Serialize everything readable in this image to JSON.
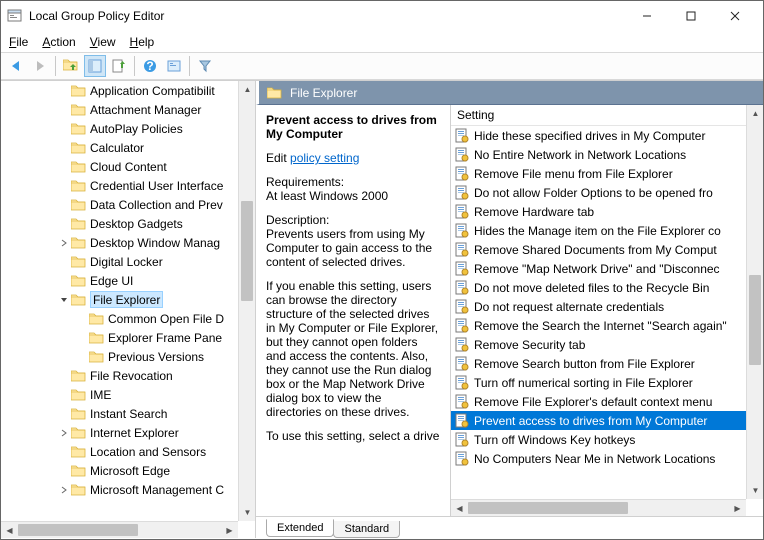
{
  "window": {
    "title": "Local Group Policy Editor"
  },
  "menu": {
    "file": "File",
    "action": "Action",
    "view": "View",
    "help": "Help"
  },
  "tree": {
    "items": [
      {
        "indent": 2,
        "exp": "",
        "label": "Application Compatibilit"
      },
      {
        "indent": 2,
        "exp": "",
        "label": "Attachment Manager"
      },
      {
        "indent": 2,
        "exp": "",
        "label": "AutoPlay Policies"
      },
      {
        "indent": 2,
        "exp": "",
        "label": "Calculator"
      },
      {
        "indent": 2,
        "exp": "",
        "label": "Cloud Content"
      },
      {
        "indent": 2,
        "exp": "",
        "label": "Credential User Interface"
      },
      {
        "indent": 2,
        "exp": "",
        "label": "Data Collection and Prev"
      },
      {
        "indent": 2,
        "exp": "",
        "label": "Desktop Gadgets"
      },
      {
        "indent": 2,
        "exp": ">",
        "label": "Desktop Window Manag"
      },
      {
        "indent": 2,
        "exp": "",
        "label": "Digital Locker"
      },
      {
        "indent": 2,
        "exp": "",
        "label": "Edge UI"
      },
      {
        "indent": 2,
        "exp": "v",
        "label": "File Explorer",
        "selected": true
      },
      {
        "indent": 3,
        "exp": "",
        "label": "Common Open File D"
      },
      {
        "indent": 3,
        "exp": "",
        "label": "Explorer Frame Pane"
      },
      {
        "indent": 3,
        "exp": "",
        "label": "Previous Versions"
      },
      {
        "indent": 2,
        "exp": "",
        "label": "File Revocation"
      },
      {
        "indent": 2,
        "exp": "",
        "label": "IME"
      },
      {
        "indent": 2,
        "exp": "",
        "label": "Instant Search"
      },
      {
        "indent": 2,
        "exp": ">",
        "label": "Internet Explorer"
      },
      {
        "indent": 2,
        "exp": "",
        "label": "Location and Sensors"
      },
      {
        "indent": 2,
        "exp": "",
        "label": "Microsoft Edge"
      },
      {
        "indent": 2,
        "exp": ">",
        "label": "Microsoft Management C"
      }
    ]
  },
  "category": {
    "title": "File Explorer"
  },
  "details": {
    "title": "Prevent access to drives from My Computer",
    "edit_label": "Edit",
    "link": "policy setting ",
    "req_label": "Requirements:",
    "req_value": "At least Windows 2000",
    "desc_label": "Description:",
    "desc_p1": "Prevents users from using My Computer to gain access to the content of selected drives.",
    "desc_p2": "If you enable this setting, users can browse the directory structure of the selected drives in My Computer or File Explorer, but they cannot open folders and access the contents. Also, they cannot use the Run dialog box or the Map Network Drive dialog box to view the directories on these drives.",
    "desc_p3": "To use this setting, select a drive"
  },
  "settings": {
    "header": "Setting",
    "items": [
      "Hide these specified drives in My Computer",
      "No Entire Network in Network Locations",
      "Remove File menu from File Explorer",
      "Do not allow Folder Options to be opened fro",
      "Remove Hardware tab",
      "Hides the Manage item on the File Explorer co",
      "Remove Shared Documents from My Comput",
      "Remove \"Map Network Drive\" and \"Disconnec",
      "Do not move deleted files to the Recycle Bin",
      "Do not request alternate credentials",
      "Remove the Search the Internet \"Search again\"",
      "Remove Security tab",
      "Remove Search button from File Explorer",
      "Turn off numerical sorting in File Explorer",
      "Remove File Explorer's default context menu",
      "Prevent access to drives from My Computer",
      "Turn off Windows Key hotkeys",
      "No Computers Near Me in Network Locations"
    ],
    "selected_index": 15
  },
  "tabs": {
    "extended": "Extended",
    "standard": "Standard"
  }
}
